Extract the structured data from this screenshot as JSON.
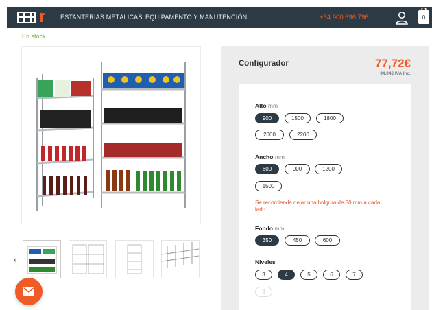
{
  "header": {
    "logo_letter": "r",
    "nav": [
      "ESTANTERÍAS METÁLICAS",
      "EQUIPAMENTO Y MANUTENCIÓN"
    ],
    "phone": "+34 900 696 796",
    "cart_count": "0",
    "icons": [
      "grid-logo-icon",
      "user-icon",
      "cart-icon"
    ]
  },
  "product": {
    "stock": "En stock",
    "thumbnails": [
      "thumb-shelf-products",
      "thumb-shelf-empty-wide",
      "thumb-shelf-empty-narrow",
      "thumb-shelf-detail"
    ],
    "prev_arrow": "‹"
  },
  "configurator": {
    "title": "Configurador",
    "price": "77,72€",
    "price_iva": "94,04€ IVA Inc.",
    "alto": {
      "label": "Alto",
      "unit": "mm",
      "options": [
        "900",
        "1500",
        "1800",
        "2000",
        "2200"
      ],
      "selected": "900"
    },
    "ancho": {
      "label": "Ancho",
      "unit": "mm",
      "options": [
        "600",
        "900",
        "1200",
        "1500"
      ],
      "selected": "600"
    },
    "note": "Se recomienda dejar una holgura de 50 mm a cada lado.",
    "fondo": {
      "label": "Fondo",
      "unit": "mm",
      "options": [
        "350",
        "450",
        "600"
      ],
      "selected": "350"
    },
    "niveles": {
      "label": "Niveles",
      "options": [
        "3",
        "4",
        "5",
        "6",
        "7",
        "8"
      ],
      "selected": "4"
    }
  },
  "colors": {
    "topbar": "#2b3a44",
    "accent": "#f15a24",
    "stock": "#7cb342",
    "panel": "#ececec"
  }
}
